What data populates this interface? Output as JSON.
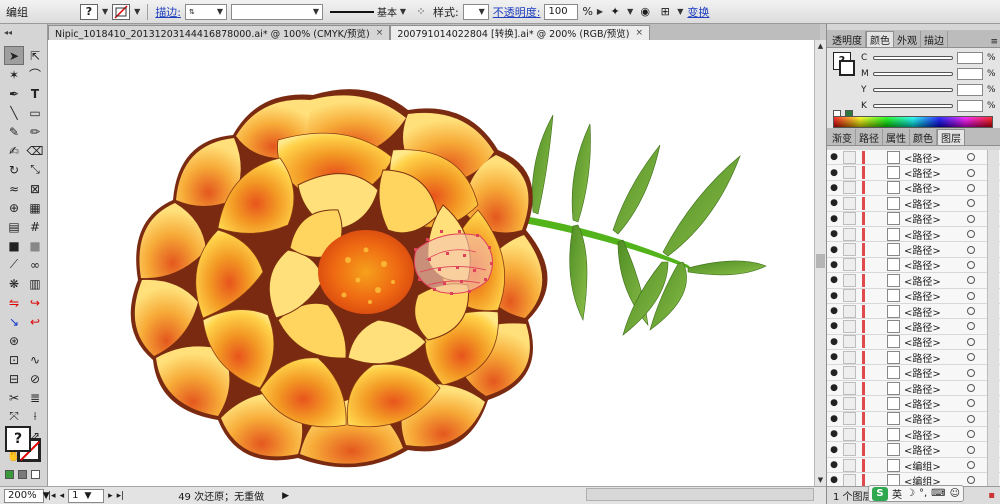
{
  "control_bar": {
    "object_type": "编组",
    "stroke_label": "描边:",
    "stroke_weight": "",
    "stroke_profile": "基本",
    "style_label": "样式:",
    "opacity_label": "不透明度:",
    "opacity_value": "100",
    "opacity_unit": "%",
    "transform_label": "变换"
  },
  "tabs": [
    {
      "label": "Nipic_1018410_20131203144416878000.ai* @ 100% (CMYK/预览)",
      "close": "×"
    },
    {
      "label": "20079101402280​4 [转换].ai* @ 200% (RGB/预览)",
      "close": "×"
    }
  ],
  "toolbox": {
    "fill_symbol": "?"
  },
  "color_panel": {
    "tabs": [
      "透明度",
      "颜色",
      "外观",
      "描边"
    ],
    "active_tab": "颜色",
    "channels": [
      {
        "letter": "C",
        "unit": "%"
      },
      {
        "letter": "M",
        "unit": "%"
      },
      {
        "letter": "Y",
        "unit": "%"
      },
      {
        "letter": "K",
        "unit": "%"
      }
    ],
    "menu_icon": "≡"
  },
  "layers_panel": {
    "tabs": [
      "渐变",
      "路径",
      "属性",
      "颜色",
      "图层"
    ],
    "active_tab": "图层",
    "rows": [
      {
        "name": "<路径>"
      },
      {
        "name": "<路径>"
      },
      {
        "name": "<路径>"
      },
      {
        "name": "<路径>"
      },
      {
        "name": "<路径>"
      },
      {
        "name": "<路径>"
      },
      {
        "name": "<路径>"
      },
      {
        "name": "<路径>"
      },
      {
        "name": "<路径>"
      },
      {
        "name": "<路径>"
      },
      {
        "name": "<路径>"
      },
      {
        "name": "<路径>"
      },
      {
        "name": "<路径>"
      },
      {
        "name": "<路径>"
      },
      {
        "name": "<路径>"
      },
      {
        "name": "<路径>"
      },
      {
        "name": "<路径>"
      },
      {
        "name": "<路径>"
      },
      {
        "name": "<路径>"
      },
      {
        "name": "<路径>"
      },
      {
        "name": "<编组>"
      },
      {
        "name": "<编组>"
      }
    ],
    "footer_count": "1 个图层"
  },
  "status_bar": {
    "zoom": "200%",
    "page": "1",
    "status_text": "49 次还原；无重做"
  },
  "ime": {
    "logo": "S",
    "lang": "英"
  },
  "colors": {
    "selection": "#e0405a",
    "petal_dark": "#e35a1e",
    "petal_mid": "#f3941e",
    "petal_light": "#ffd34a",
    "leaf": "#5a9a2a",
    "stem": "#52b41a"
  }
}
